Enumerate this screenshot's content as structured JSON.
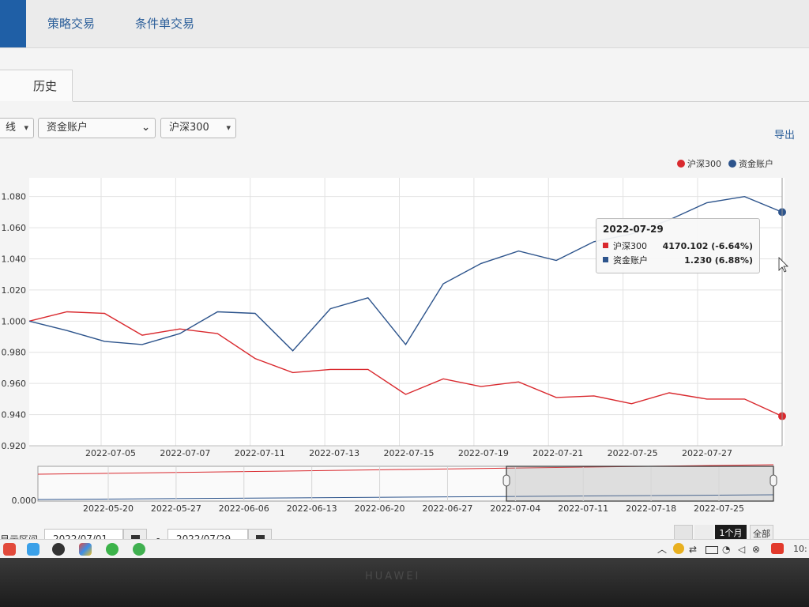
{
  "nav": {
    "tabs": [
      {
        "label": "",
        "active": true
      },
      {
        "label": "策略交易",
        "active": false
      },
      {
        "label": "条件单交易",
        "active": false
      }
    ]
  },
  "subtab": {
    "label": "历史"
  },
  "filters": {
    "type_select": {
      "value": "线"
    },
    "account_select": {
      "value": "资金账户"
    },
    "benchmark_select": {
      "value": "沪深300"
    }
  },
  "export_label": "导出",
  "legend": [
    {
      "label": "沪深300",
      "color": "#d9292e"
    },
    {
      "label": "资金账户",
      "color": "#2d548c"
    }
  ],
  "tooltip": {
    "date": "2022-07-29",
    "rows": [
      {
        "name": "沪深300",
        "value": "4170.102 (-6.64%)",
        "color": "#d9292e"
      },
      {
        "name": "资金账户",
        "value": "1.230 (6.88%)",
        "color": "#2d548c"
      }
    ]
  },
  "chart_data": {
    "type": "line",
    "x_ticks": [
      "2022-07-05",
      "2022-07-07",
      "2022-07-11",
      "2022-07-13",
      "2022-07-15",
      "2022-07-19",
      "2022-07-21",
      "2022-07-25",
      "2022-07-27"
    ],
    "y_ticks": [
      "0.920",
      "0.940",
      "0.960",
      "0.980",
      "1.000",
      "1.020",
      "1.040",
      "1.060",
      "1.080"
    ],
    "ylim": [
      0.92,
      1.092
    ],
    "grid": true,
    "legend_position": "top-right",
    "series": [
      {
        "name": "沪深300",
        "color": "#d9292e",
        "values": [
          1.0,
          1.006,
          1.005,
          0.991,
          0.995,
          0.992,
          0.976,
          0.967,
          0.969,
          0.969,
          0.953,
          0.963,
          0.958,
          0.961,
          0.951,
          0.952,
          0.947,
          0.954,
          0.95,
          0.95,
          0.939
        ]
      },
      {
        "name": "资金账户",
        "color": "#2d548c",
        "values": [
          1.0,
          0.994,
          0.987,
          0.985,
          0.992,
          1.006,
          1.005,
          0.981,
          1.008,
          1.015,
          0.985,
          1.024,
          1.037,
          1.045,
          1.039,
          1.051,
          1.056,
          1.065,
          1.076,
          1.08,
          1.07
        ]
      }
    ]
  },
  "navigator": {
    "y_label": "0.000",
    "x_ticks": [
      "2022-05-20",
      "2022-05-27",
      "2022-06-06",
      "2022-06-13",
      "2022-06-20",
      "2022-06-27",
      "2022-07-04",
      "2022-07-11",
      "2022-07-18",
      "2022-07-25"
    ],
    "window_start": 0.637,
    "window_end": 0.98
  },
  "range": {
    "label": "显示区间",
    "start": "2022/07/01",
    "end": "2022/07/29",
    "dash": "-"
  },
  "zoom_buttons": [
    "",
    "",
    "1个月",
    "全部"
  ],
  "taskbar": {
    "clock": "10:"
  },
  "bezel": {
    "brand": "HUAWEI"
  }
}
